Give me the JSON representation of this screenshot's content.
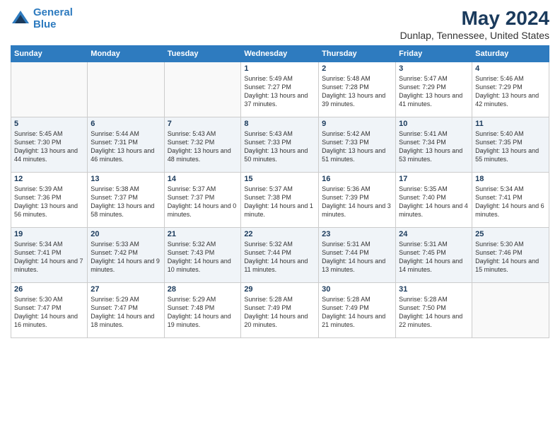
{
  "logo": {
    "line1": "General",
    "line2": "Blue"
  },
  "title": "May 2024",
  "subtitle": "Dunlap, Tennessee, United States",
  "days_of_week": [
    "Sunday",
    "Monday",
    "Tuesday",
    "Wednesday",
    "Thursday",
    "Friday",
    "Saturday"
  ],
  "weeks": [
    [
      {
        "day": "",
        "info": ""
      },
      {
        "day": "",
        "info": ""
      },
      {
        "day": "",
        "info": ""
      },
      {
        "day": "1",
        "info": "Sunrise: 5:49 AM\nSunset: 7:27 PM\nDaylight: 13 hours and 37 minutes."
      },
      {
        "day": "2",
        "info": "Sunrise: 5:48 AM\nSunset: 7:28 PM\nDaylight: 13 hours and 39 minutes."
      },
      {
        "day": "3",
        "info": "Sunrise: 5:47 AM\nSunset: 7:29 PM\nDaylight: 13 hours and 41 minutes."
      },
      {
        "day": "4",
        "info": "Sunrise: 5:46 AM\nSunset: 7:29 PM\nDaylight: 13 hours and 42 minutes."
      }
    ],
    [
      {
        "day": "5",
        "info": "Sunrise: 5:45 AM\nSunset: 7:30 PM\nDaylight: 13 hours and 44 minutes."
      },
      {
        "day": "6",
        "info": "Sunrise: 5:44 AM\nSunset: 7:31 PM\nDaylight: 13 hours and 46 minutes."
      },
      {
        "day": "7",
        "info": "Sunrise: 5:43 AM\nSunset: 7:32 PM\nDaylight: 13 hours and 48 minutes."
      },
      {
        "day": "8",
        "info": "Sunrise: 5:43 AM\nSunset: 7:33 PM\nDaylight: 13 hours and 50 minutes."
      },
      {
        "day": "9",
        "info": "Sunrise: 5:42 AM\nSunset: 7:33 PM\nDaylight: 13 hours and 51 minutes."
      },
      {
        "day": "10",
        "info": "Sunrise: 5:41 AM\nSunset: 7:34 PM\nDaylight: 13 hours and 53 minutes."
      },
      {
        "day": "11",
        "info": "Sunrise: 5:40 AM\nSunset: 7:35 PM\nDaylight: 13 hours and 55 minutes."
      }
    ],
    [
      {
        "day": "12",
        "info": "Sunrise: 5:39 AM\nSunset: 7:36 PM\nDaylight: 13 hours and 56 minutes."
      },
      {
        "day": "13",
        "info": "Sunrise: 5:38 AM\nSunset: 7:37 PM\nDaylight: 13 hours and 58 minutes."
      },
      {
        "day": "14",
        "info": "Sunrise: 5:37 AM\nSunset: 7:37 PM\nDaylight: 14 hours and 0 minutes."
      },
      {
        "day": "15",
        "info": "Sunrise: 5:37 AM\nSunset: 7:38 PM\nDaylight: 14 hours and 1 minute."
      },
      {
        "day": "16",
        "info": "Sunrise: 5:36 AM\nSunset: 7:39 PM\nDaylight: 14 hours and 3 minutes."
      },
      {
        "day": "17",
        "info": "Sunrise: 5:35 AM\nSunset: 7:40 PM\nDaylight: 14 hours and 4 minutes."
      },
      {
        "day": "18",
        "info": "Sunrise: 5:34 AM\nSunset: 7:41 PM\nDaylight: 14 hours and 6 minutes."
      }
    ],
    [
      {
        "day": "19",
        "info": "Sunrise: 5:34 AM\nSunset: 7:41 PM\nDaylight: 14 hours and 7 minutes."
      },
      {
        "day": "20",
        "info": "Sunrise: 5:33 AM\nSunset: 7:42 PM\nDaylight: 14 hours and 9 minutes."
      },
      {
        "day": "21",
        "info": "Sunrise: 5:32 AM\nSunset: 7:43 PM\nDaylight: 14 hours and 10 minutes."
      },
      {
        "day": "22",
        "info": "Sunrise: 5:32 AM\nSunset: 7:44 PM\nDaylight: 14 hours and 11 minutes."
      },
      {
        "day": "23",
        "info": "Sunrise: 5:31 AM\nSunset: 7:44 PM\nDaylight: 14 hours and 13 minutes."
      },
      {
        "day": "24",
        "info": "Sunrise: 5:31 AM\nSunset: 7:45 PM\nDaylight: 14 hours and 14 minutes."
      },
      {
        "day": "25",
        "info": "Sunrise: 5:30 AM\nSunset: 7:46 PM\nDaylight: 14 hours and 15 minutes."
      }
    ],
    [
      {
        "day": "26",
        "info": "Sunrise: 5:30 AM\nSunset: 7:47 PM\nDaylight: 14 hours and 16 minutes."
      },
      {
        "day": "27",
        "info": "Sunrise: 5:29 AM\nSunset: 7:47 PM\nDaylight: 14 hours and 18 minutes."
      },
      {
        "day": "28",
        "info": "Sunrise: 5:29 AM\nSunset: 7:48 PM\nDaylight: 14 hours and 19 minutes."
      },
      {
        "day": "29",
        "info": "Sunrise: 5:28 AM\nSunset: 7:49 PM\nDaylight: 14 hours and 20 minutes."
      },
      {
        "day": "30",
        "info": "Sunrise: 5:28 AM\nSunset: 7:49 PM\nDaylight: 14 hours and 21 minutes."
      },
      {
        "day": "31",
        "info": "Sunrise: 5:28 AM\nSunset: 7:50 PM\nDaylight: 14 hours and 22 minutes."
      },
      {
        "day": "",
        "info": ""
      }
    ]
  ]
}
